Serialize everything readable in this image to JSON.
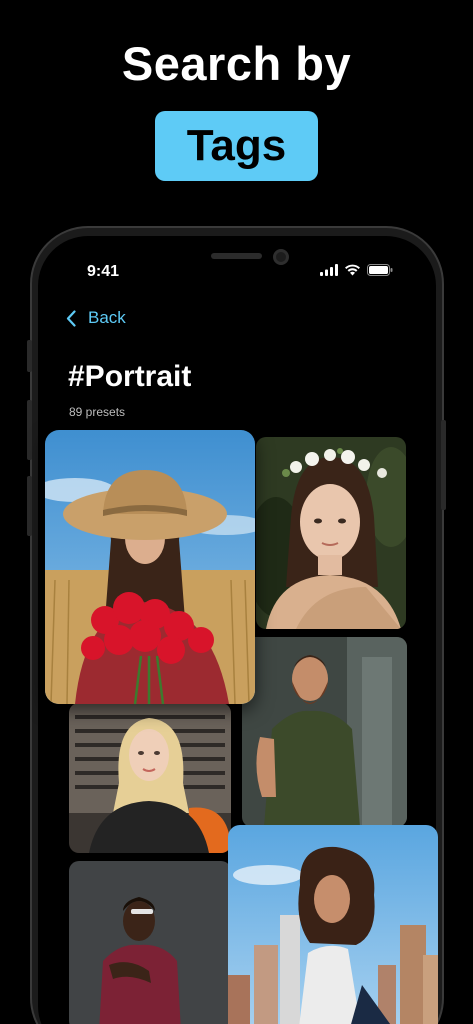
{
  "promo": {
    "headline": "Search by",
    "tag_highlight": "Tags"
  },
  "status_bar": {
    "time": "9:41",
    "icons": [
      "signal-icon",
      "wifi-icon",
      "battery-icon"
    ]
  },
  "nav": {
    "back_label": "Back",
    "back_icon": "chevron-left-icon"
  },
  "page": {
    "title": "#Portrait",
    "preset_count": "89 presets"
  },
  "gallery": {
    "photos": [
      {
        "name": "photo-woman-sun-hat-red-flowers"
      },
      {
        "name": "photo-woman-flower-crown"
      },
      {
        "name": "photo-blonde-woman-orange-truck"
      },
      {
        "name": "photo-bearded-man-green-shirt"
      },
      {
        "name": "photo-man-burgundy-sweater"
      },
      {
        "name": "photo-woman-curly-hair-city"
      }
    ]
  },
  "colors": {
    "accent": "#5ecbf6",
    "background": "#000000",
    "phone_frame": "#1b1b1b"
  }
}
